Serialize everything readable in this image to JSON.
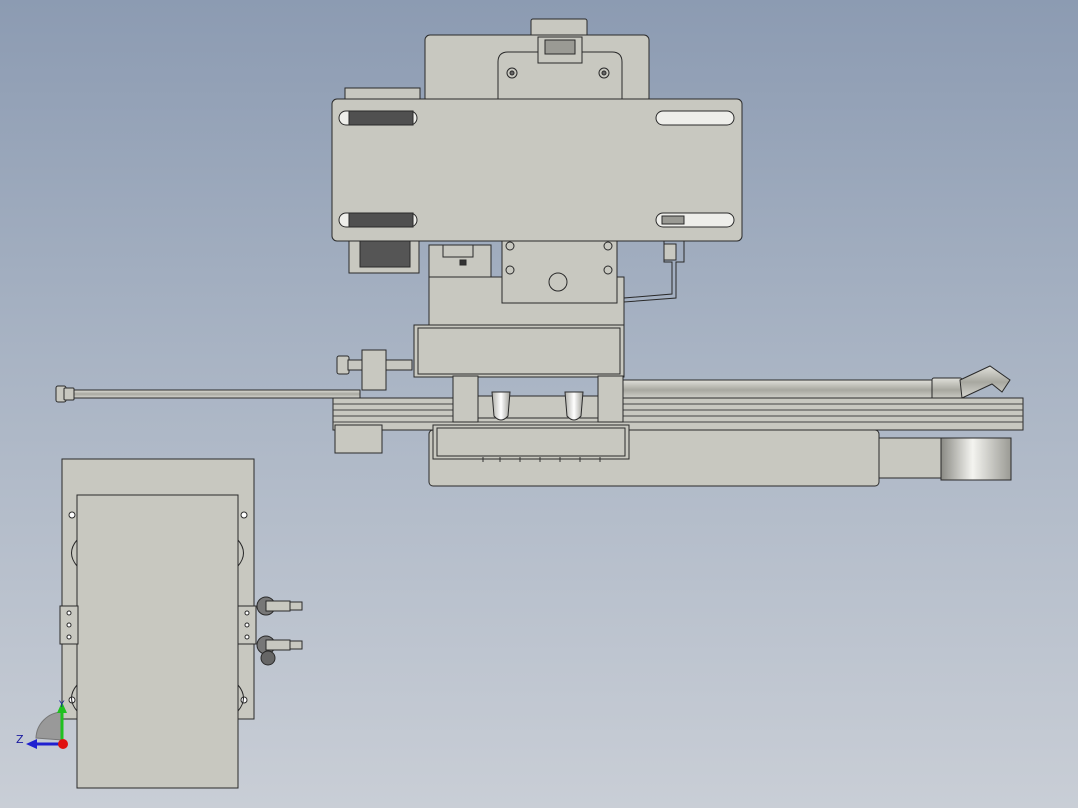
{
  "viewport": {
    "background_top": "#8c9bb2",
    "background_bottom": "#c9ced6",
    "part_fill": "#c8c8c0",
    "part_stroke": "#2a2a2a",
    "slot_fill": "#eeeeea"
  },
  "triad": {
    "x_label": "",
    "y_label": "Y",
    "z_label": "Z",
    "y_color": "#20c020",
    "z_color": "#2020d0",
    "origin_color": "#e01010"
  }
}
